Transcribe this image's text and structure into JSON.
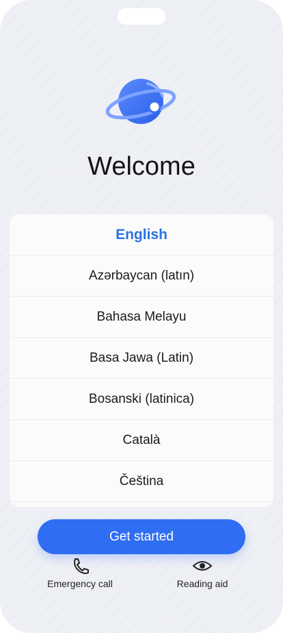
{
  "welcome": "Welcome",
  "languages": [
    "English",
    "Azərbaycan (latın)",
    "Bahasa Melayu",
    "Basa Jawa (Latin)",
    "Bosanski (latinica)",
    "Català",
    "Čeština"
  ],
  "selected_language_index": 0,
  "cta": "Get started",
  "actions": {
    "emergency_call": "Emergency call",
    "reading_aid": "Reading aid"
  },
  "colors": {
    "accent": "#2f6df2",
    "selected_text": "#2a72e3",
    "background": "#eef0f5"
  },
  "icons": {
    "logo": "planet-orbit-icon",
    "emergency": "phone-icon",
    "reading": "eye-icon"
  }
}
